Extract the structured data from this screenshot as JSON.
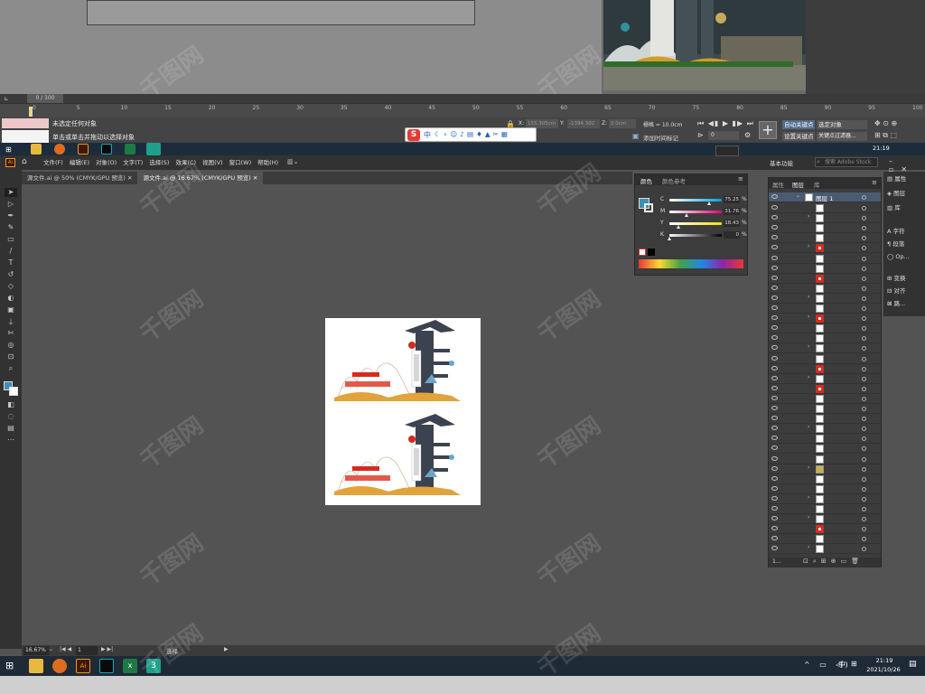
{
  "max3d": {
    "frame_counter": "0 / 100",
    "ruler_ticks": [
      "0",
      "5",
      "10",
      "15",
      "20",
      "25",
      "30",
      "35",
      "40",
      "45",
      "50",
      "55",
      "60",
      "65",
      "70",
      "75",
      "80",
      "85",
      "90",
      "95",
      "100"
    ],
    "status_line1": "未选定任何对象",
    "status_line2": "单击或单击并拖动以选择对象",
    "x_label": "X:",
    "x_value": "155.305cm",
    "y_label": "Y:",
    "y_value": "-1394.302",
    "z_label": "Z:",
    "z_value": "0.0cm",
    "grid_label": "栅格 = 10.0cm",
    "time_tag_label": "添加时间标记",
    "autokey_label": "自动关键点",
    "setkey_label": "设置关键点",
    "select_dropdown": "选定对象",
    "key_filter_label": "关键点过滤器...",
    "frame_input": "0"
  },
  "ime_bar": {
    "label": "中"
  },
  "top_taskbar": {
    "time": "21:19"
  },
  "illustrator": {
    "menu": [
      "文件(F)",
      "编辑(E)",
      "对象(O)",
      "文字(T)",
      "选择(S)",
      "效果(C)",
      "视图(V)",
      "窗口(W)",
      "帮助(H)"
    ],
    "workspace": "基本功能",
    "search_placeholder": "搜索 Adobe Stock",
    "tabs": [
      {
        "label": "源文件.ai @ 50% (CMYK/GPU 预览)"
      },
      {
        "label": "源文件.ai @ 16.67% (CMYK/GPU 预览)"
      }
    ],
    "color_panel": {
      "tab_color": "颜色",
      "tab_guide": "颜色参考",
      "rows": [
        {
          "label": "C",
          "value": "75.25",
          "unit": "%",
          "fill": 0.75
        },
        {
          "label": "M",
          "value": "31.76",
          "unit": "%",
          "fill": 0.32
        },
        {
          "label": "Y",
          "value": "18.43",
          "unit": "%",
          "fill": 0.18
        },
        {
          "label": "K",
          "value": "0",
          "unit": "%",
          "fill": 0.0
        }
      ],
      "fill_color": "#3d8fb5"
    },
    "layers_panel": {
      "tab_properties": "属性",
      "tab_layers": "图层",
      "tab_library": "库",
      "layer_name": "图层 1",
      "footer_count": "1..."
    },
    "right_dock": [
      "属性",
      "图层",
      "库",
      "字符",
      "段落",
      "Op...",
      "变换",
      "对齐",
      "路..."
    ],
    "status": {
      "zoom": "16.67%",
      "page": "1",
      "mode": "选择"
    }
  },
  "taskbar": {
    "time": "21:19",
    "date": "2021/10/26",
    "ime": "中"
  },
  "watermark": "千图网"
}
